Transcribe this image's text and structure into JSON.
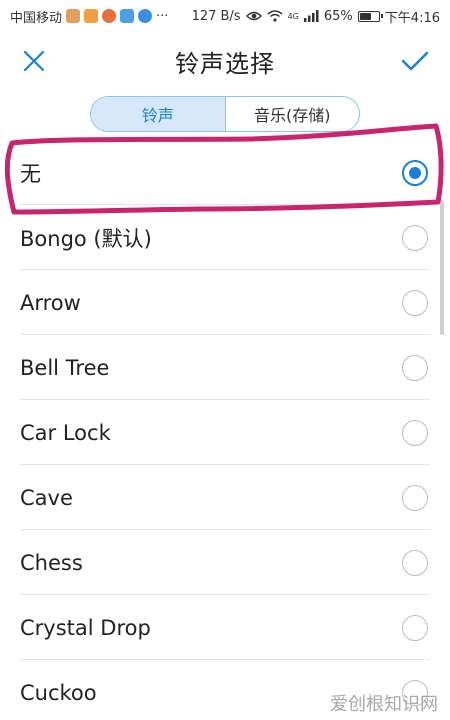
{
  "status_bar": {
    "carrier": "中国移动",
    "more": "···",
    "speed": "127 B/s",
    "network_type": "4G",
    "battery": "65%",
    "battery_level": 0.65,
    "time": "下午4:16"
  },
  "header": {
    "title": "铃声选择",
    "close_icon": "close-icon",
    "confirm_icon": "check-icon"
  },
  "tabs": [
    {
      "label": "铃声",
      "active": true
    },
    {
      "label": "音乐(存储)",
      "active": false
    }
  ],
  "ringtones": [
    {
      "label": "无",
      "selected": true
    },
    {
      "label": "Bongo (默认)",
      "selected": false
    },
    {
      "label": "Arrow",
      "selected": false
    },
    {
      "label": "Bell Tree",
      "selected": false
    },
    {
      "label": "Car Lock",
      "selected": false
    },
    {
      "label": "Cave",
      "selected": false
    },
    {
      "label": "Chess",
      "selected": false
    },
    {
      "label": "Crystal Drop",
      "selected": false
    },
    {
      "label": "Cuckoo",
      "selected": false
    }
  ],
  "colors": {
    "accent": "#1a7fd6",
    "annotation": "#c8256e"
  },
  "watermark": "爱创根知识网"
}
